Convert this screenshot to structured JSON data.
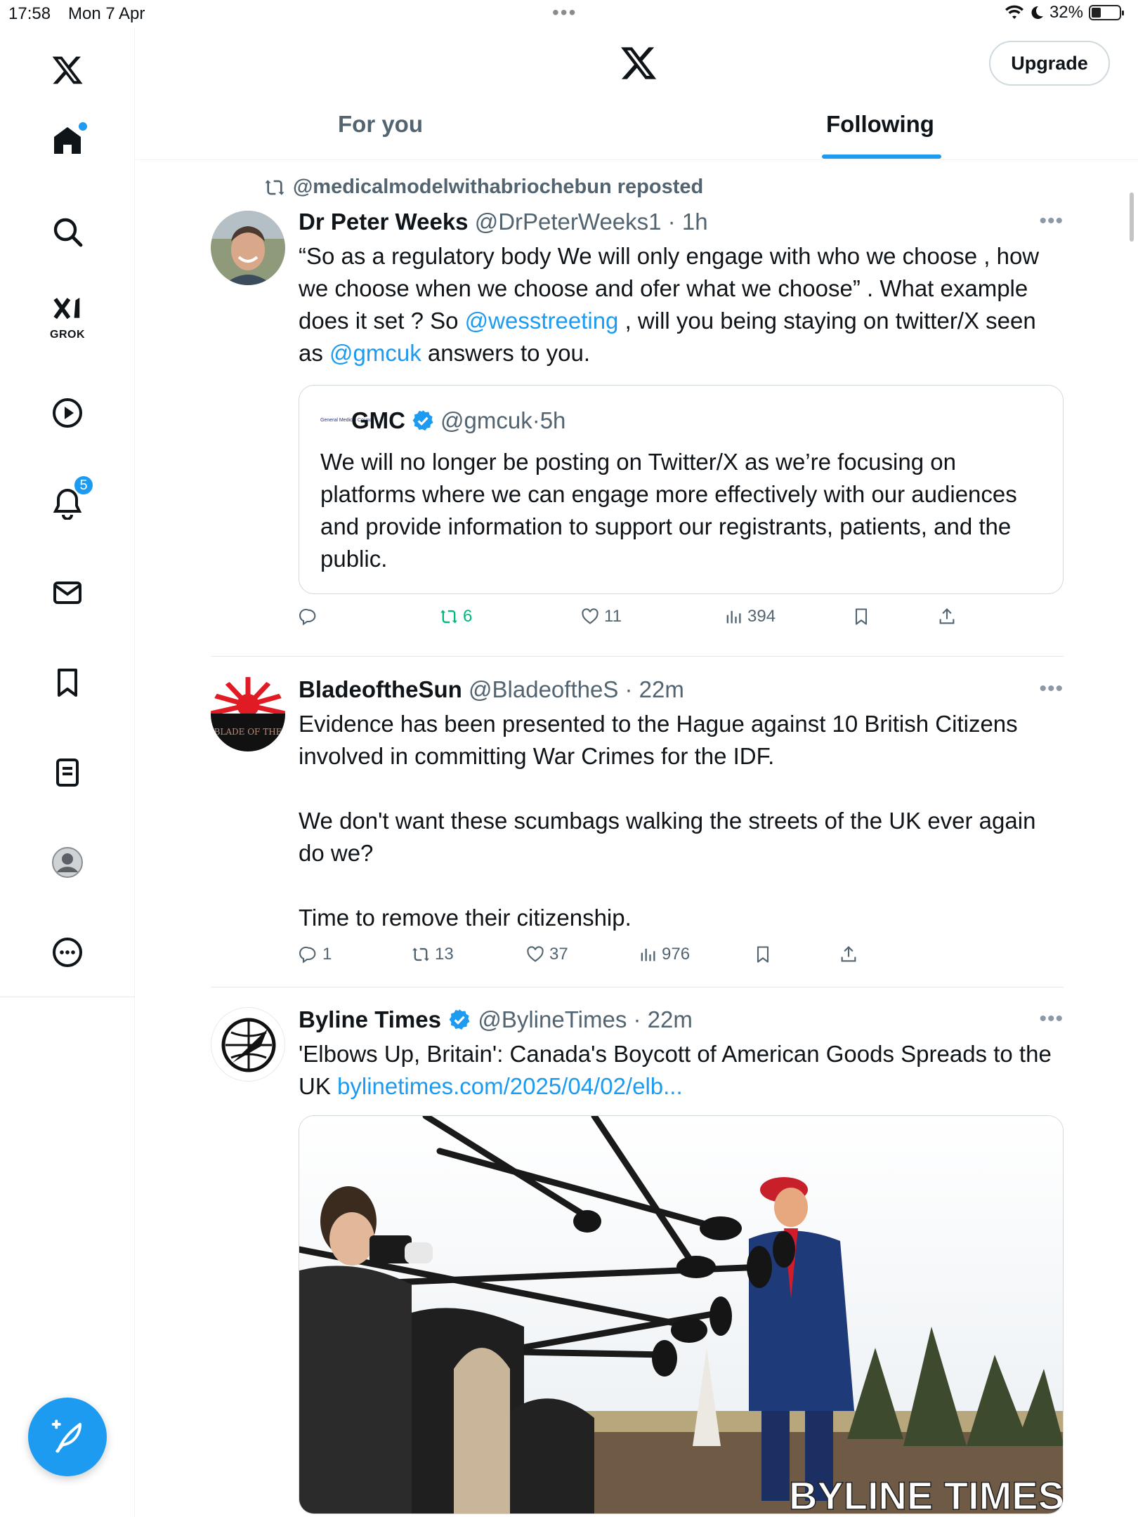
{
  "status_bar": {
    "time": "17:58",
    "date": "Mon 7 Apr",
    "battery": "32%"
  },
  "sidebar": {
    "grok_label": "GROK",
    "notification_count": "5"
  },
  "header": {
    "upgrade_label": "Upgrade",
    "tabs": [
      {
        "label": "For you",
        "active": false
      },
      {
        "label": "Following",
        "active": true
      }
    ]
  },
  "tweets": [
    {
      "repost_line": "@medicalmodelwithabriochebun reposted",
      "name": "Dr Peter Weeks",
      "handle": "@DrPeterWeeks1",
      "time": "1h",
      "text_parts": [
        "“So as a regulatory body We will only engage with who we choose , how we choose when we choose and ofer what we choose” . What example does it set ? So ",
        "@wesstreeting",
        " , will you being staying on twitter/X seen as ",
        "@gmcuk",
        " answers to you."
      ],
      "quote": {
        "logo_text": "General Medical Council",
        "name": "GMC",
        "handle": "@gmcuk",
        "time": "5h",
        "text": "We will no longer be posting on Twitter/X as we’re focusing on platforms where we can engage more effectively with our audiences and provide information to support our registrants, patients, and the public."
      },
      "replies": "",
      "retweets": "6",
      "likes": "11",
      "views": "394"
    },
    {
      "name": "BladeoftheSun",
      "handle": "@BladeoftheS",
      "time": "22m",
      "avatar_text": "BLADE OF THE",
      "paragraphs": [
        "Evidence has been presented to the Hague against 10 British Citizens involved in committing War Crimes for the IDF.",
        "We don't want these scumbags walking the streets of the UK ever again do we?",
        "Time to remove their citizenship."
      ],
      "replies": "1",
      "retweets": "13",
      "likes": "37",
      "views": "976"
    },
    {
      "name": "Byline Times",
      "handle": "@BylineTimes",
      "time": "22m",
      "text": "'Elbows Up, Britain': Canada's Boycott of American Goods Spreads to the UK ",
      "link": "bylinetimes.com/2025/04/02/elb...",
      "media_watermark": "BYLINE TIMES"
    }
  ],
  "colors": {
    "accent": "#1d9bf0",
    "secondary_text": "#536471",
    "retweet_active": "#00ba7c"
  }
}
